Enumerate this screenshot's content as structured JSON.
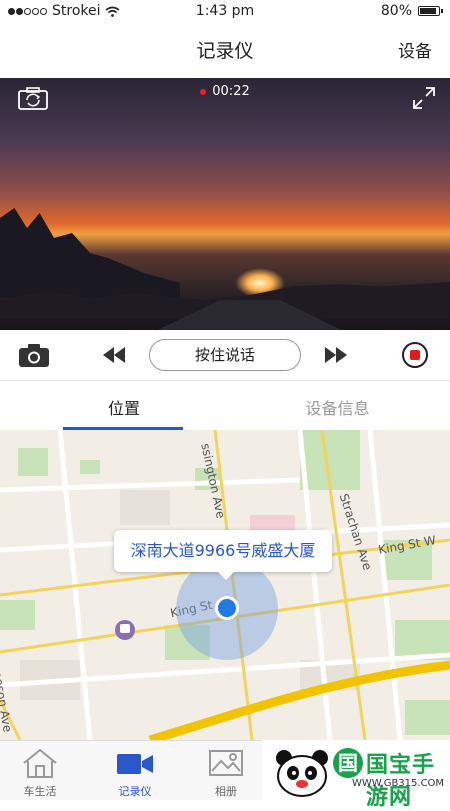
{
  "status_bar": {
    "carrier": "Strokei",
    "time": "1:43 pm",
    "battery": "80%"
  },
  "nav": {
    "title": "记录仪",
    "right_button": "设备"
  },
  "video": {
    "recording_time": "00:22"
  },
  "controls": {
    "push_to_talk": "按住说话"
  },
  "tabs": [
    {
      "label": "位置",
      "active": true
    },
    {
      "label": "设备信息",
      "active": false
    }
  ],
  "map": {
    "address_bubble": "深南大道9966号威盛大厦",
    "streets": {
      "s1": "ssington Ave",
      "s2": "Strachan Ave",
      "s3": "King St W",
      "s4": "King St",
      "s5": "eeson Ave"
    }
  },
  "tabbar": [
    {
      "label": "车生活"
    },
    {
      "label": "记录仪",
      "active": true
    },
    {
      "label": "相册"
    }
  ],
  "watermark": {
    "text": "国宝手游网",
    "badge": "国",
    "url": "WWW.GB315.COM"
  },
  "colors": {
    "accent": "#2a57c9",
    "record": "#e21b1b",
    "location": "#1e7ae6",
    "watermark": "#17a34a"
  }
}
